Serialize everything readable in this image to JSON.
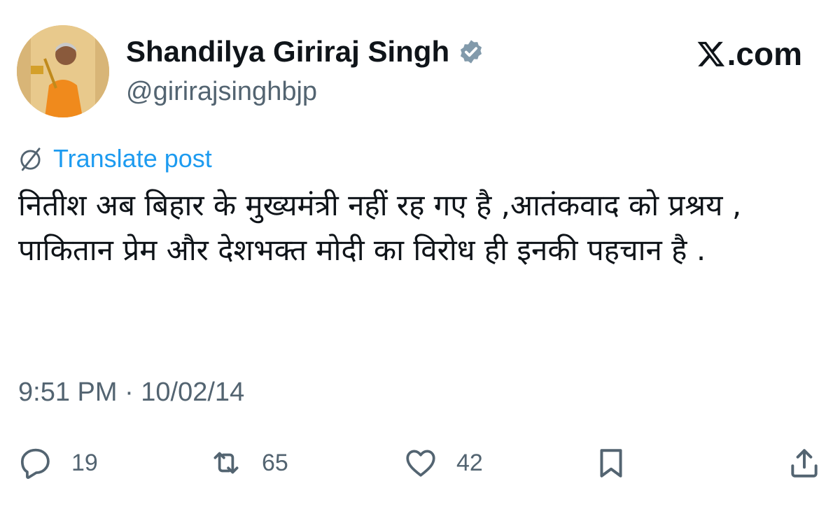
{
  "author": {
    "display_name": "Shandilya Giriraj Singh",
    "handle": "@girirajsinghbjp",
    "verified": true
  },
  "brand": {
    "label": ".com"
  },
  "translate": {
    "label": "Translate post"
  },
  "post": {
    "text": "नितीश अब बिहार के मुख्यमंत्री नहीं रह गए है ,आतंकवाद को प्रश्रय , पाकितान प्रेम और देशभक्त मोदी का विरोध ही इनकी पहचान है ."
  },
  "meta": {
    "timestamp": "9:51 PM · 10/02/14"
  },
  "actions": {
    "replies": "19",
    "reposts": "65",
    "likes": "42"
  },
  "colors": {
    "text": "#0f1419",
    "secondary": "#536471",
    "link": "#1d9bf0"
  }
}
